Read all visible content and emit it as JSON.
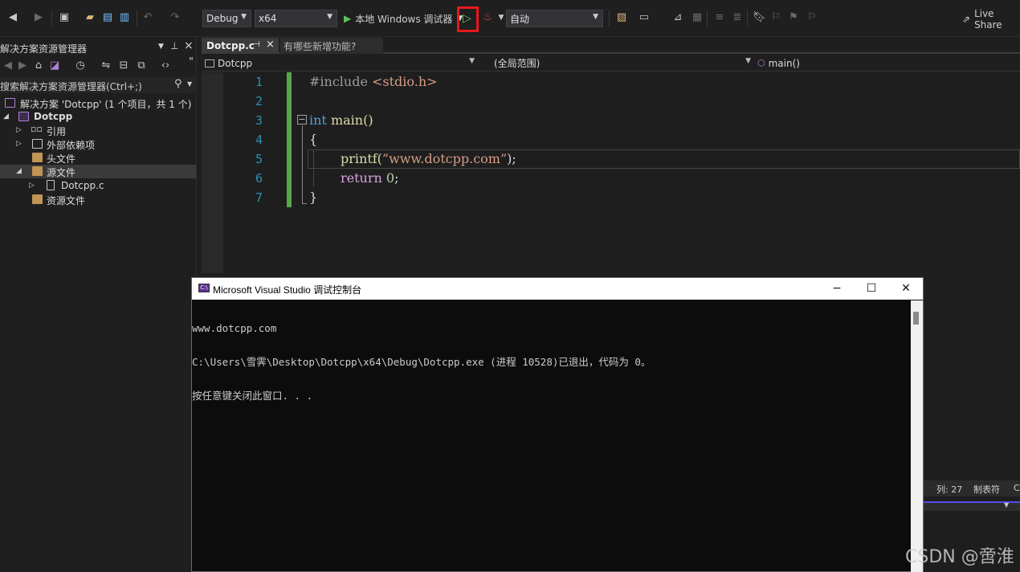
{
  "toolbar": {
    "config": "Debug",
    "platform": "x64",
    "start_debugger_label": "本地 Windows 调试器",
    "run_mode": "自动",
    "live_share": "Live Share"
  },
  "solution_explorer": {
    "title": "解决方案资源管理器",
    "search_placeholder": "搜索解决方案资源管理器(Ctrl+;)",
    "items": [
      {
        "label": "解决方案 'Dotcpp' (1 个项目，共 1 个)"
      },
      {
        "label": "Dotcpp"
      },
      {
        "label": "引用"
      },
      {
        "label": "外部依赖项"
      },
      {
        "label": "头文件"
      },
      {
        "label": "源文件"
      },
      {
        "label": "Dotcpp.c"
      },
      {
        "label": "资源文件"
      }
    ]
  },
  "editor": {
    "tabs": [
      {
        "label": "Dotcpp.c"
      },
      {
        "label": "有哪些新增功能?"
      }
    ],
    "nav": {
      "project": "Dotcpp",
      "scope": "(全局范围)",
      "member": "main()"
    },
    "line_numbers": [
      "1",
      "2",
      "3",
      "4",
      "5",
      "6",
      "7"
    ],
    "code": {
      "l1_pp": "#include",
      "l1_hdr": " <stdio.h>",
      "l3_kw": "int",
      "l3_fn": " main()",
      "l4": "{",
      "l5_fn": "printf(",
      "l5_str": "”www.dotcpp.com”",
      "l5_end": ");",
      "l6_kw": "return",
      "l6_num": " 0",
      "l6_end": ";",
      "l7": "}"
    }
  },
  "status": {
    "col": "列: 27",
    "tab": "制表符",
    "enc": "C"
  },
  "console": {
    "title": "Microsoft Visual Studio 调试控制台",
    "lines": [
      "www.dotcpp.com",
      "C:\\Users\\雪霁\\Desktop\\Dotcpp\\x64\\Debug\\Dotcpp.exe (进程 10528)已退出，代码为 0。",
      "按任意键关闭此窗口. . ."
    ]
  },
  "watermark": "CSDN @啻淮"
}
